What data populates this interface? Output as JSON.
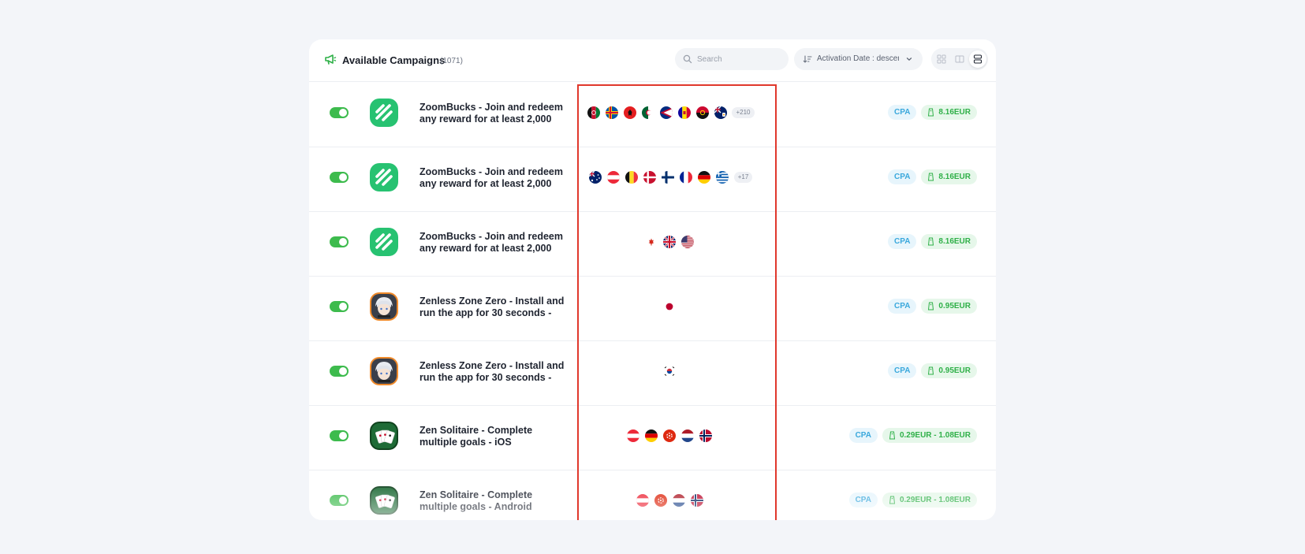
{
  "header": {
    "title": "Available Campaigns",
    "count": "(1071)",
    "icon": "megaphone-icon",
    "accent": "#2fb048"
  },
  "search": {
    "placeholder": "Search",
    "value": ""
  },
  "sort": {
    "label": "Activation Date : descen...",
    "icon": "sort-descending-icon"
  },
  "view_toggle": {
    "options": [
      "grid-icon",
      "columns-icon",
      "list-icon"
    ],
    "selected": "list-icon"
  },
  "campaigns": [
    {
      "enabled": true,
      "icon": "zoombucks-app-icon",
      "name": "ZoomBucks - Join and redeem any reward for at least 2,000",
      "countries": [
        "Afghanistan",
        "Åland Islands",
        "Albania",
        "Algeria",
        "American Samoa",
        "Andorra",
        "Angola",
        "Anguilla"
      ],
      "more_countries": "+210",
      "type": "CPA",
      "payout": "8.16EUR"
    },
    {
      "enabled": true,
      "icon": "zoombucks-app-icon",
      "name": "ZoomBucks - Join and redeem any reward for at least 2,000",
      "countries": [
        "Australia",
        "Austria",
        "Belgium",
        "Denmark",
        "Finland",
        "France",
        "Germany",
        "Greece"
      ],
      "more_countries": "+17",
      "type": "CPA",
      "payout": "8.16EUR"
    },
    {
      "enabled": true,
      "icon": "zoombucks-app-icon",
      "name": "ZoomBucks - Join and redeem any reward for at least 2,000",
      "countries": [
        "Canada",
        "United Kingdom",
        "United States"
      ],
      "more_countries": "",
      "type": "CPA",
      "payout": "8.16EUR"
    },
    {
      "enabled": true,
      "icon": "zenless-zone-zero-app-icon",
      "name": "Zenless Zone Zero - Install and run the app for 30 seconds -",
      "countries": [
        "Japan"
      ],
      "more_countries": "",
      "type": "CPA",
      "payout": "0.95EUR"
    },
    {
      "enabled": true,
      "icon": "zenless-zone-zero-app-icon",
      "name": "Zenless Zone Zero - Install and run the app for 30 seconds -",
      "countries": [
        "South Korea"
      ],
      "more_countries": "",
      "type": "CPA",
      "payout": "0.95EUR"
    },
    {
      "enabled": true,
      "icon": "zen-solitaire-app-icon",
      "name": "Zen Solitaire - Complete multiple goals - iOS",
      "countries": [
        "Austria",
        "Germany",
        "Hong Kong",
        "Netherlands",
        "Norway"
      ],
      "more_countries": "",
      "type": "CPA",
      "payout": "0.29EUR - 1.08EUR"
    },
    {
      "enabled": true,
      "icon": "zen-solitaire-app-icon",
      "name": "Zen Solitaire - Complete multiple goals - Android",
      "countries": [
        "Austria",
        "Hong Kong",
        "Netherlands",
        "Norway"
      ],
      "more_countries": "",
      "type": "CPA",
      "payout": "0.29EUR - 1.08EUR"
    }
  ],
  "colors": {
    "toggle_on": "#3dbb4d",
    "cpa_text": "#3aa8dc",
    "payout_text": "#2fb048",
    "highlight_box": "#e0382c"
  }
}
